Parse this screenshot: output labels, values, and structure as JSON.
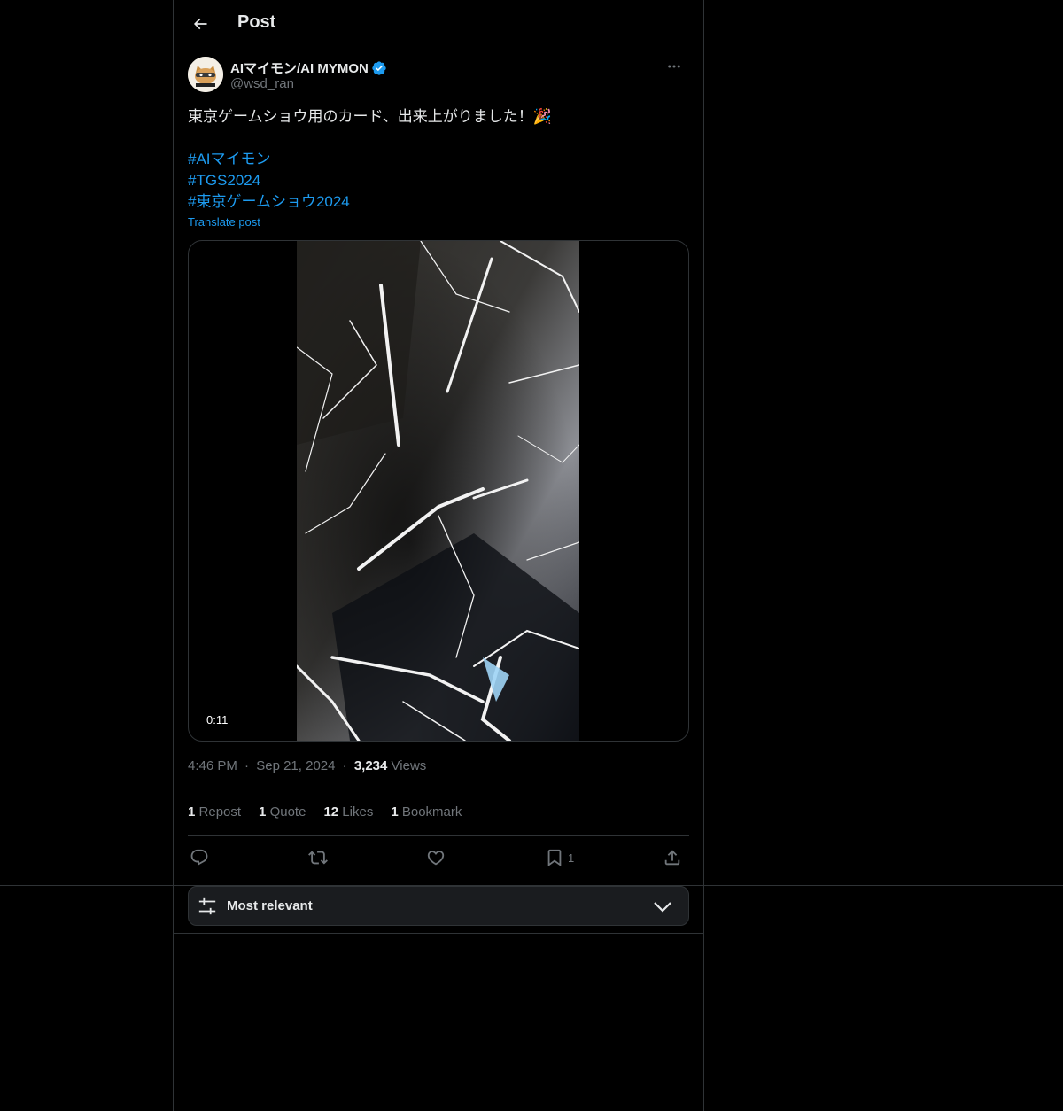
{
  "header": {
    "title": "Post"
  },
  "author": {
    "display_name": "AIマイモン/AI MYMON",
    "handle": "@wsd_ran",
    "verified": true,
    "avatar_text": "AIマイモン"
  },
  "tweet": {
    "line1": "東京ゲームショウ用のカード、出来上がりました！🎉",
    "hashtags": [
      "#AIマイモン",
      "#TGS2024",
      "#東京ゲームショウ2024"
    ],
    "translate_label": "Translate post"
  },
  "media": {
    "duration": "0:11"
  },
  "meta": {
    "time": "4:46 PM",
    "date": "Sep 21, 2024",
    "views_count": "3,234",
    "views_label": "Views",
    "separator": "·"
  },
  "stats": {
    "reposts_count": "1",
    "reposts_label": "Repost",
    "quotes_count": "1",
    "quotes_label": "Quote",
    "likes_count": "12",
    "likes_label": "Likes",
    "bookmarks_count": "1",
    "bookmarks_label": "Bookmark"
  },
  "actions": {
    "reply_icon": "reply-icon",
    "repost_icon": "repost-icon",
    "like_icon": "heart-icon",
    "bookmark_icon": "bookmark-icon",
    "bookmark_count": "1",
    "share_icon": "share-icon"
  },
  "sort": {
    "label": "Most relevant"
  },
  "colors": {
    "background": "#000000",
    "text": "#e7e9ea",
    "secondary_text": "#71767b",
    "link": "#1d9bf0",
    "border": "#2f3336",
    "verified": "#1d9bf0"
  }
}
